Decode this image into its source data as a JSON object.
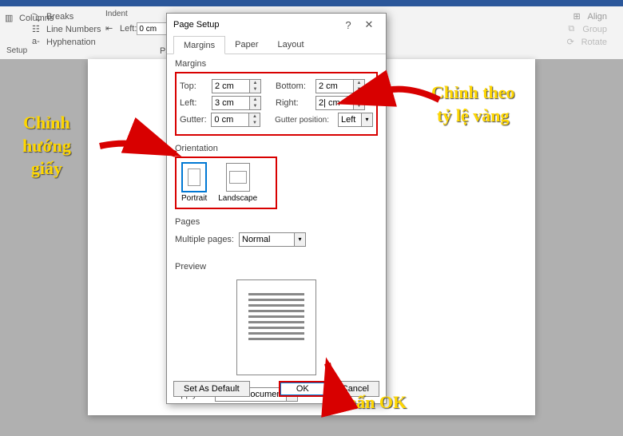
{
  "ribbon": {
    "breaks": "Breaks",
    "line_numbers": "Line Numbers",
    "hyphenation": "Hyphenation",
    "columns": "Columns",
    "setup_label": "Setup",
    "paragraph_label": "Paragra",
    "indent_label": "Indent",
    "left_label": "Left:",
    "left_val": "0 cm",
    "align": "Align",
    "group": "Group",
    "rotate": "Rotate"
  },
  "dialog": {
    "title": "Page Setup",
    "tabs": {
      "margins": "Margins",
      "paper": "Paper",
      "layout": "Layout"
    },
    "margins": {
      "label": "Margins",
      "top_label": "Top:",
      "top_val": "2 cm",
      "bottom_label": "Bottom:",
      "bottom_val": "2 cm",
      "left_label": "Left:",
      "left_val": "3 cm",
      "right_label": "Right:",
      "right_val": "2| cm",
      "gutter_label": "Gutter:",
      "gutter_val": "0 cm",
      "gutter_pos_label": "Gutter position:",
      "gutter_pos_val": "Left"
    },
    "orientation": {
      "label": "Orientation",
      "portrait": "Portrait",
      "landscape": "Landscape"
    },
    "pages": {
      "label": "Pages",
      "multiple_label": "Multiple pages:",
      "multiple_val": "Normal"
    },
    "preview_label": "Preview",
    "apply_label": "Apply to:",
    "apply_val": "Whole document",
    "set_default": "Set As Default",
    "ok": "OK",
    "cancel": "Cancel"
  },
  "annotations": {
    "left": "Chỉnh\nhướng\ngiấy",
    "right": "Chỉnh theo\ntỷ lệ vàng",
    "bottom": "Nhấn OK"
  }
}
